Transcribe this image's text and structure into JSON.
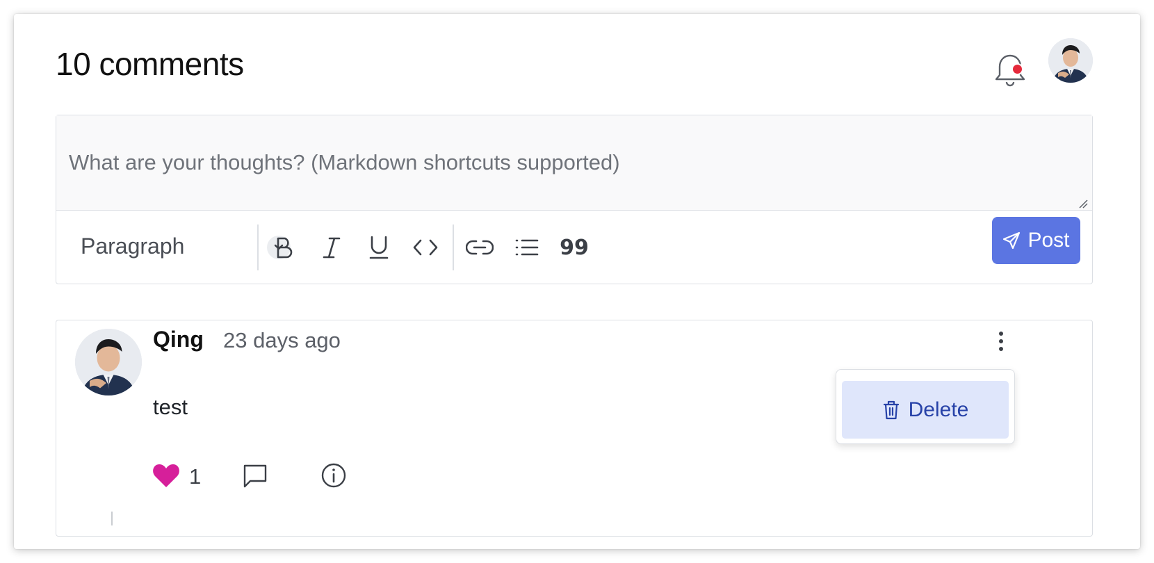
{
  "header": {
    "title": "10 comments",
    "notifications": {
      "icon": "bell-icon",
      "has_unread": true,
      "dot_color": "#e5293b"
    },
    "user_avatar": "avatar"
  },
  "editor": {
    "placeholder": "What are your thoughts? (Markdown shortcuts supported)",
    "block_type": "Paragraph",
    "tools": [
      "bold-icon",
      "italic-icon",
      "underline-icon",
      "code-icon",
      "link-icon",
      "list-icon",
      "quote-icon"
    ],
    "quote_glyph": "99",
    "post_label": "Post",
    "post_color": "#5b75e2"
  },
  "comment": {
    "author": "Qing",
    "time": "23 days ago",
    "text": "test",
    "likes": "1",
    "heart_color": "#d61f9a",
    "menu": {
      "delete_label": "Delete"
    }
  }
}
